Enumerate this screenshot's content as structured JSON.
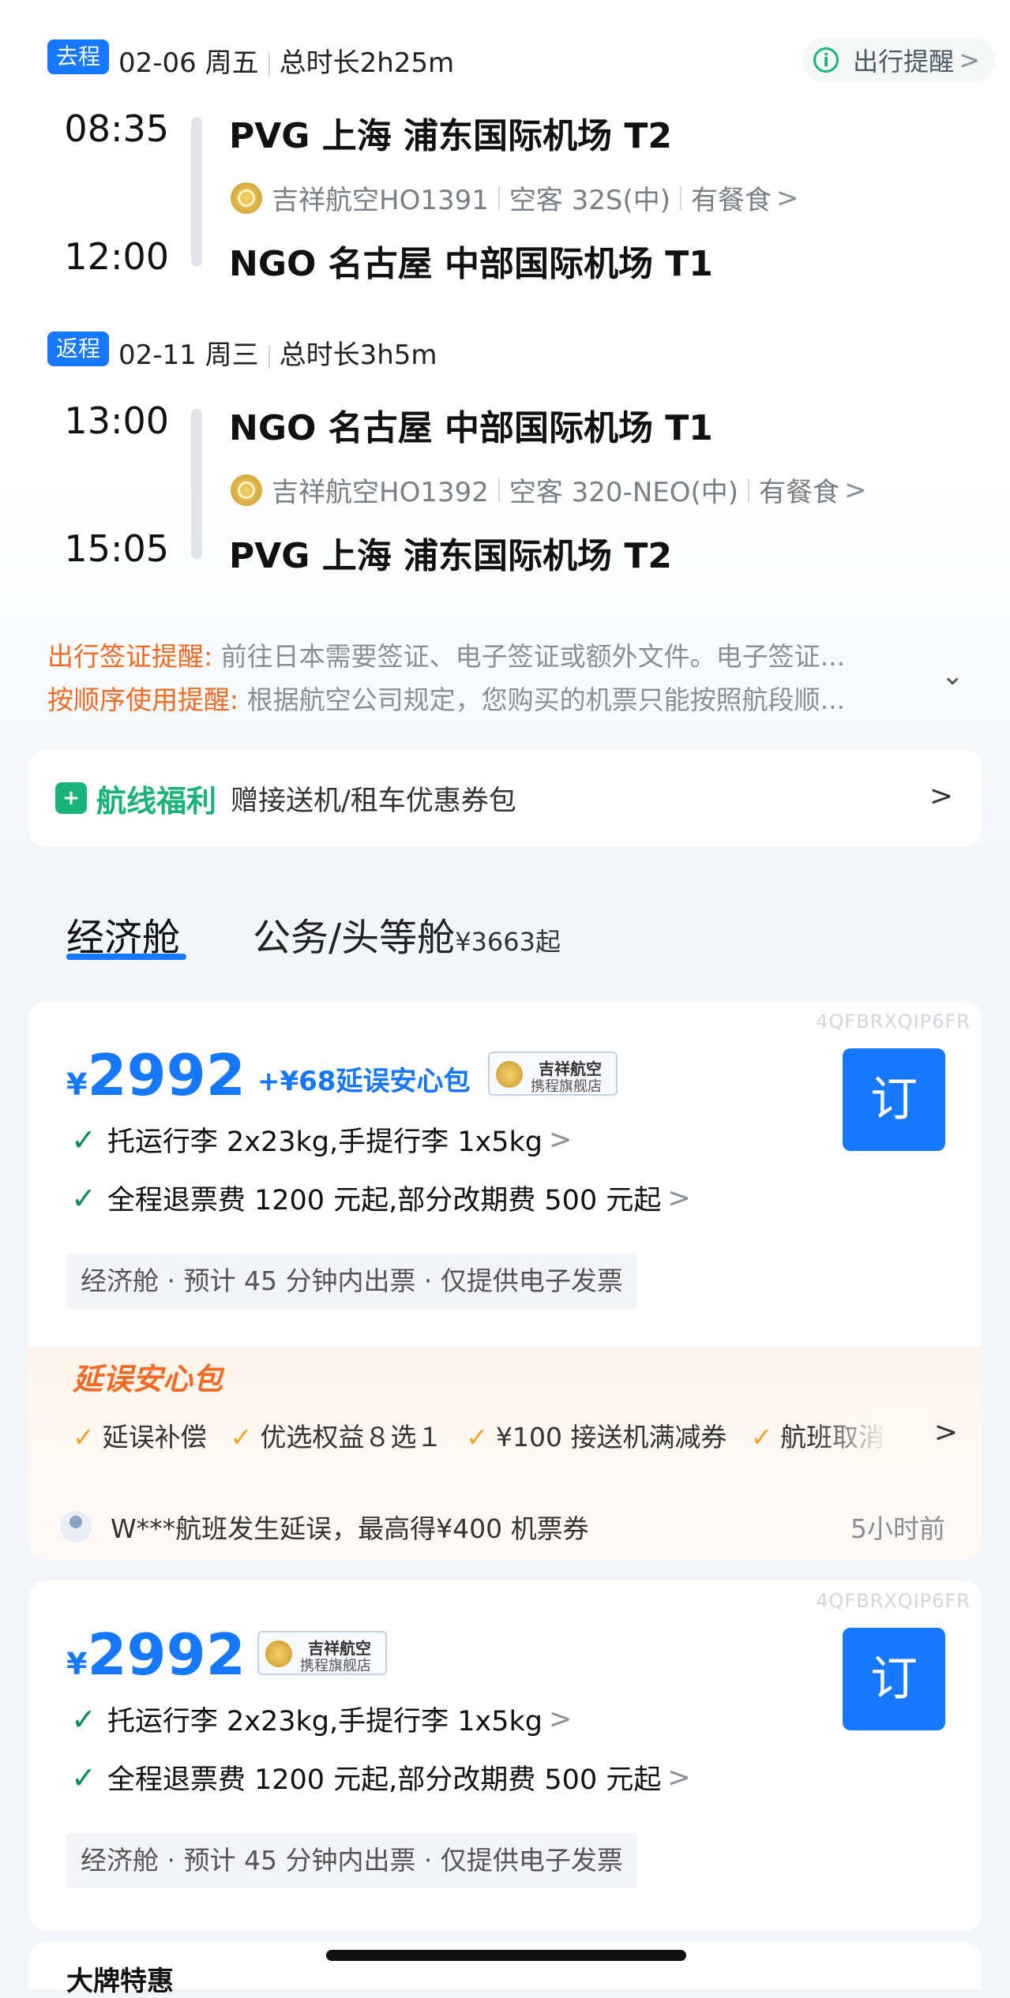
{
  "outbound": {
    "tag": "去程",
    "date": "02-06 周五",
    "duration": "总时长2h25m",
    "dep_time": "08:35",
    "dep_airport": "PVG  上海 浦东国际机场 T2",
    "airline_flight": "吉祥航空HO1391",
    "aircraft": "空客 32S(中)",
    "meal": "有餐食",
    "arr_time": "12:00",
    "arr_airport": "NGO  名古屋 中部国际机场 T1"
  },
  "reminder": {
    "label": "出行提醒"
  },
  "return": {
    "tag": "返程",
    "date": "02-11 周三",
    "duration": "总时长3h5m",
    "dep_time": "13:00",
    "dep_airport": "NGO  名古屋 中部国际机场 T1",
    "airline_flight": "吉祥航空HO1392",
    "aircraft": "空客 320-NEO(中)",
    "meal": "有餐食",
    "arr_time": "15:05",
    "arr_airport": "PVG  上海 浦东国际机场 T2"
  },
  "notices": [
    {
      "label": "出行签证提醒:",
      "text": "前往日本需要签证、电子签证或额外文件。电子签证..."
    },
    {
      "label": "按顺序使用提醒:",
      "text": "根据航空公司规定，您购买的机票只能按照航段顺..."
    }
  ],
  "benefit": {
    "title": "航线福利",
    "desc": "赠接送机/租车优惠券包"
  },
  "cabin_tabs": {
    "economy": "经济舱",
    "business": "公务/头等舱",
    "business_price": "¥3663起"
  },
  "offers": [
    {
      "code": "4QFBRXQIP6FR",
      "currency": "¥",
      "price": "2992",
      "addon": "+¥68延误安心包",
      "store_line1": "吉祥航空",
      "store_line2": "携程旗舰店",
      "book": "订",
      "baggage": "托运行李 2x23kg,手提行李 1x5kg",
      "refund": "全程退票费 1200 元起,部分改期费 500 元起",
      "chip": "经济舱 · 预计 45 分钟内出票 · 仅提供电子发票",
      "delay_title": "延误安心包",
      "perks": [
        "延误补偿",
        "优选权益８选１",
        "¥100 接送机满减券",
        "航班取消"
      ],
      "ticker_text": "W***航班发生延误，最高得¥400 机票券",
      "ticker_time": "5小时前"
    },
    {
      "code": "4QFBRXQIP6FR",
      "currency": "¥",
      "price": "2992",
      "store_line1": "吉祥航空",
      "store_line2": "携程旗舰店",
      "book": "订",
      "baggage": "托运行李 2x23kg,手提行李 1x5kg",
      "refund": "全程退票费 1200 元起,部分改期费 500 元起",
      "chip": "经济舱 · 预计 45 分钟内出票 · 仅提供电子发票"
    }
  ],
  "next_card_title": "大牌特惠"
}
